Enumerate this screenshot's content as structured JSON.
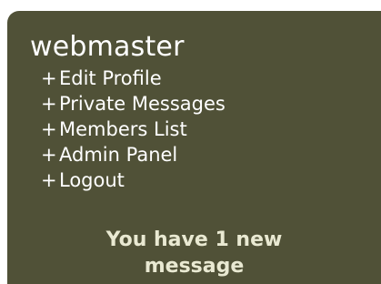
{
  "user_panel": {
    "username": "webmaster",
    "menu_prefix": "+",
    "menu_items": [
      {
        "label": "Edit Profile"
      },
      {
        "label": "Private Messages"
      },
      {
        "label": "Members List"
      },
      {
        "label": "Admin Panel"
      },
      {
        "label": "Logout"
      }
    ],
    "notice_line1": "You have 1 new",
    "notice_line2": "message",
    "colors": {
      "panel_background": "#505137",
      "text": "#ffffff",
      "notice_text": "#e9e9d2"
    }
  }
}
